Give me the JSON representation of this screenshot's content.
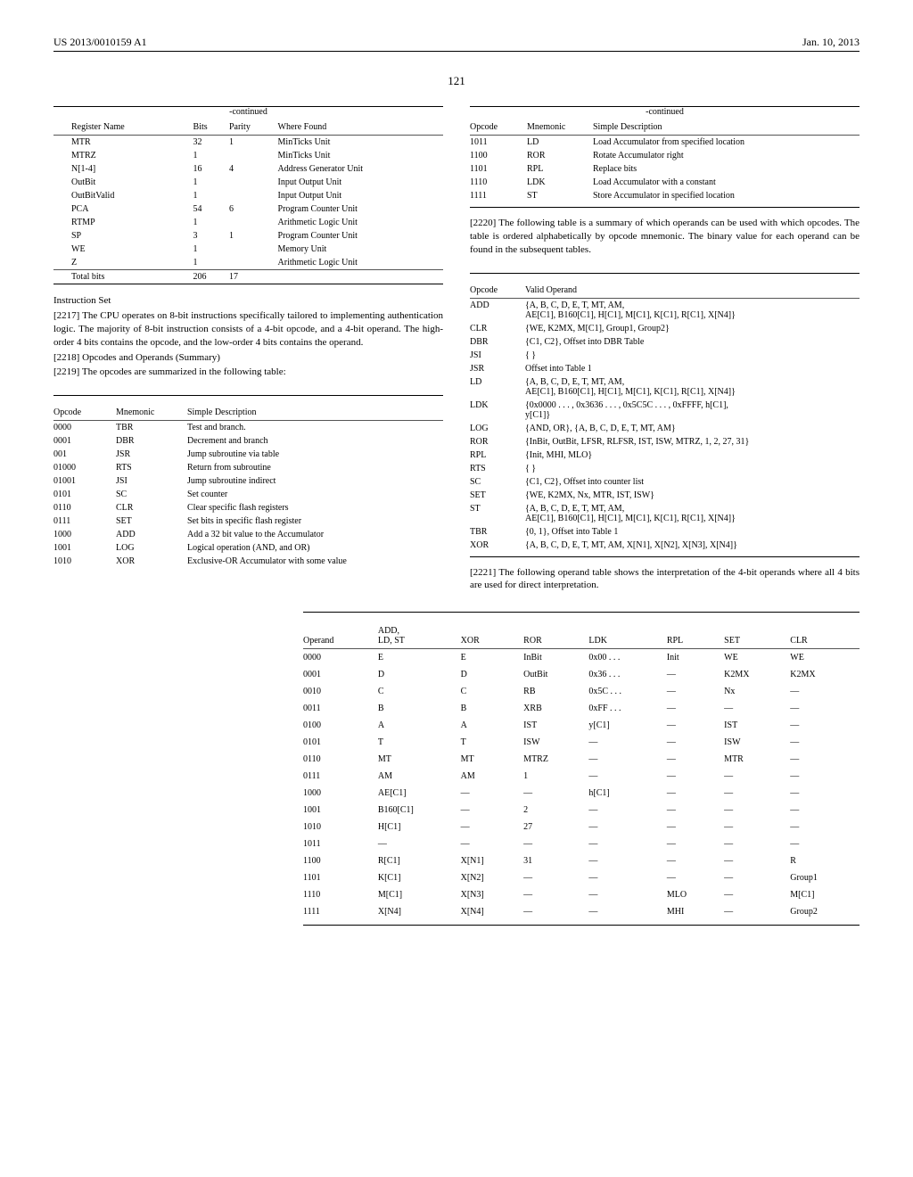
{
  "header": {
    "pubno": "US 2013/0010159 A1",
    "date": "Jan. 10, 2013"
  },
  "page_number": "121",
  "table1": {
    "caption": "-continued",
    "headers": [
      "Register Name",
      "Bits",
      "Parity",
      "Where Found"
    ],
    "rows": [
      [
        "MTR",
        "32",
        "1",
        "MinTicks Unit"
      ],
      [
        "MTRZ",
        "1",
        "",
        "MinTicks Unit"
      ],
      [
        "N[1-4]",
        "16",
        "4",
        "Address Generator Unit"
      ],
      [
        "OutBit",
        "1",
        "",
        "Input Output Unit"
      ],
      [
        "OutBitValid",
        "1",
        "",
        "Input Output Unit"
      ],
      [
        "PCA",
        "54",
        "6",
        "Program Counter Unit"
      ],
      [
        "RTMP",
        "1",
        "",
        "Arithmetic Logic Unit"
      ],
      [
        "SP",
        "3",
        "1",
        "Program Counter Unit"
      ],
      [
        "WE",
        "1",
        "",
        "Memory Unit"
      ],
      [
        "Z",
        "1",
        "",
        "Arithmetic Logic Unit"
      ]
    ],
    "total_row": [
      "Total bits",
      "206",
      "17",
      ""
    ]
  },
  "section1_heading": "Instruction Set",
  "paras": {
    "p2217": "[2217]   The CPU operates on 8-bit instructions specifically tailored to implementing authentication logic. The majority of 8-bit instruction consists of a 4-bit opcode, and a 4-bit operand. The high-order 4 bits contains the opcode, and the low-order 4 bits contains the operand.",
    "p2218": "[2218]   Opcodes and Operands (Summary)",
    "p2219": "[2219]   The opcodes are summarized in the following table:",
    "p2220": "[2220]   The following table is a summary of which operands can be used with which opcodes. The table is ordered alphabetically by opcode mnemonic. The binary value for each operand can be found in the subsequent tables.",
    "p2221": "[2221]   The following operand table shows the interpretation of the 4-bit operands where all 4 bits are used for direct interpretation."
  },
  "table3": {
    "headers": [
      "Opcode",
      "Mnemonic",
      "Simple Description"
    ],
    "rows": [
      [
        "0000",
        "TBR",
        "Test and branch."
      ],
      [
        "0001",
        "DBR",
        "Decrement and branch"
      ],
      [
        "001",
        "JSR",
        "Jump subroutine via table"
      ],
      [
        "01000",
        "RTS",
        "Return from subroutine"
      ],
      [
        "01001",
        "JSI",
        "Jump subroutine indirect"
      ],
      [
        "0101",
        "SC",
        "Set counter"
      ],
      [
        "0110",
        "CLR",
        "Clear specific flash registers"
      ],
      [
        "0111",
        "SET",
        "Set bits in specific flash register"
      ],
      [
        "1000",
        "ADD",
        "Add a 32 bit value to the Accumulator"
      ],
      [
        "1001",
        "LOG",
        "Logical operation (AND, and OR)"
      ],
      [
        "1010",
        "XOR",
        "Exclusive-OR Accumulator with some value"
      ]
    ]
  },
  "table4": {
    "caption": "-continued",
    "headers": [
      "Opcode",
      "Mnemonic",
      "Simple Description"
    ],
    "rows": [
      [
        "1011",
        "LD",
        "Load Accumulator from specified location"
      ],
      [
        "1100",
        "ROR",
        "Rotate Accumulator right"
      ],
      [
        "1101",
        "RPL",
        "Replace bits"
      ],
      [
        "1110",
        "LDK",
        "Load Accumulator with a constant"
      ],
      [
        "1111",
        "ST",
        "Store Accumulator in specified location"
      ]
    ]
  },
  "table5": {
    "headers": [
      "Opcode",
      "Valid Operand"
    ],
    "rows": [
      [
        "ADD",
        "{A, B, C, D, E, T, MT, AM,\nAE[C1], B160[C1], H[C1], M[C1], K[C1], R[C1], X[N4]}"
      ],
      [
        "CLR",
        "{WE, K2MX, M[C1], Group1, Group2}"
      ],
      [
        "DBR",
        "{C1, C2}, Offset into DBR Table"
      ],
      [
        "JSI",
        "{ }"
      ],
      [
        "JSR",
        "Offset into Table 1"
      ],
      [
        "LD",
        "{A, B, C, D, E, T, MT, AM,\nAE[C1], B160[C1], H[C1], M[C1], K[C1], R[C1], X[N4]}"
      ],
      [
        "LDK",
        "{0x0000 . . . , 0x3636 . . . , 0x5C5C . . . , 0xFFFF, h[C1],\ny[C1]}"
      ],
      [
        "LOG",
        "{AND, OR}, {A, B, C, D, E, T, MT, AM}"
      ],
      [
        "ROR",
        "{InBit, OutBit, LFSR, RLFSR, IST, ISW, MTRZ, 1, 2, 27, 31}"
      ],
      [
        "RPL",
        "{Init, MHI, MLO}"
      ],
      [
        "RTS",
        "{ }"
      ],
      [
        "SC",
        "{C1, C2}, Offset into counter list"
      ],
      [
        "SET",
        "{WE, K2MX, Nx, MTR, IST, ISW}"
      ],
      [
        "ST",
        "{A, B, C, D, E, T, MT, AM,\nAE[C1], B160[C1], H[C1], M[C1], K[C1], R[C1], X[N4]}"
      ],
      [
        "TBR",
        "{0, 1}, Offset into Table 1"
      ],
      [
        "XOR",
        "{A, B, C, D, E, T, MT, AM, X[N1], X[N2], X[N3], X[N4]}"
      ]
    ]
  },
  "table6": {
    "headers": [
      "Operand",
      "ADD,\nLD, ST",
      "XOR",
      "ROR",
      "LDK",
      "RPL",
      "SET",
      "CLR"
    ],
    "rows": [
      [
        "0000",
        "E",
        "E",
        "InBit",
        "0x00 . . .",
        "Init",
        "WE",
        "WE"
      ],
      [
        "0001",
        "D",
        "D",
        "OutBit",
        "0x36 . . .",
        "—",
        "K2MX",
        "K2MX"
      ],
      [
        "0010",
        "C",
        "C",
        "RB",
        "0x5C . . .",
        "—",
        "Nx",
        "—"
      ],
      [
        "0011",
        "B",
        "B",
        "XRB",
        "0xFF . . .",
        "—",
        "—",
        "—"
      ],
      [
        "0100",
        "A",
        "A",
        "IST",
        "y[C1]",
        "—",
        "IST",
        "—"
      ],
      [
        "0101",
        "T",
        "T",
        "ISW",
        "—",
        "—",
        "ISW",
        "—"
      ],
      [
        "0110",
        "MT",
        "MT",
        "MTRZ",
        "—",
        "—",
        "MTR",
        "—"
      ],
      [
        "0111",
        "AM",
        "AM",
        "1",
        "—",
        "—",
        "—",
        "—"
      ],
      [
        "1000",
        "AE[C1]",
        "—",
        "—",
        "h[C1]",
        "—",
        "—",
        "—"
      ],
      [
        "1001",
        "B160[C1]",
        "—",
        "2",
        "—",
        "—",
        "—",
        "—"
      ],
      [
        "1010",
        "H[C1]",
        "—",
        "27",
        "—",
        "—",
        "—",
        "—"
      ],
      [
        "1011",
        "—",
        "—",
        "—",
        "—",
        "—",
        "—",
        "—"
      ],
      [
        "1100",
        "R[C1]",
        "X[N1]",
        "31",
        "—",
        "—",
        "—",
        "R"
      ],
      [
        "1101",
        "K[C1]",
        "X[N2]",
        "—",
        "—",
        "—",
        "—",
        "Group1"
      ],
      [
        "1110",
        "M[C1]",
        "X[N3]",
        "—",
        "—",
        "MLO",
        "—",
        "M[C1]"
      ],
      [
        "1111",
        "X[N4]",
        "X[N4]",
        "—",
        "—",
        "MHI",
        "—",
        "Group2"
      ]
    ]
  }
}
